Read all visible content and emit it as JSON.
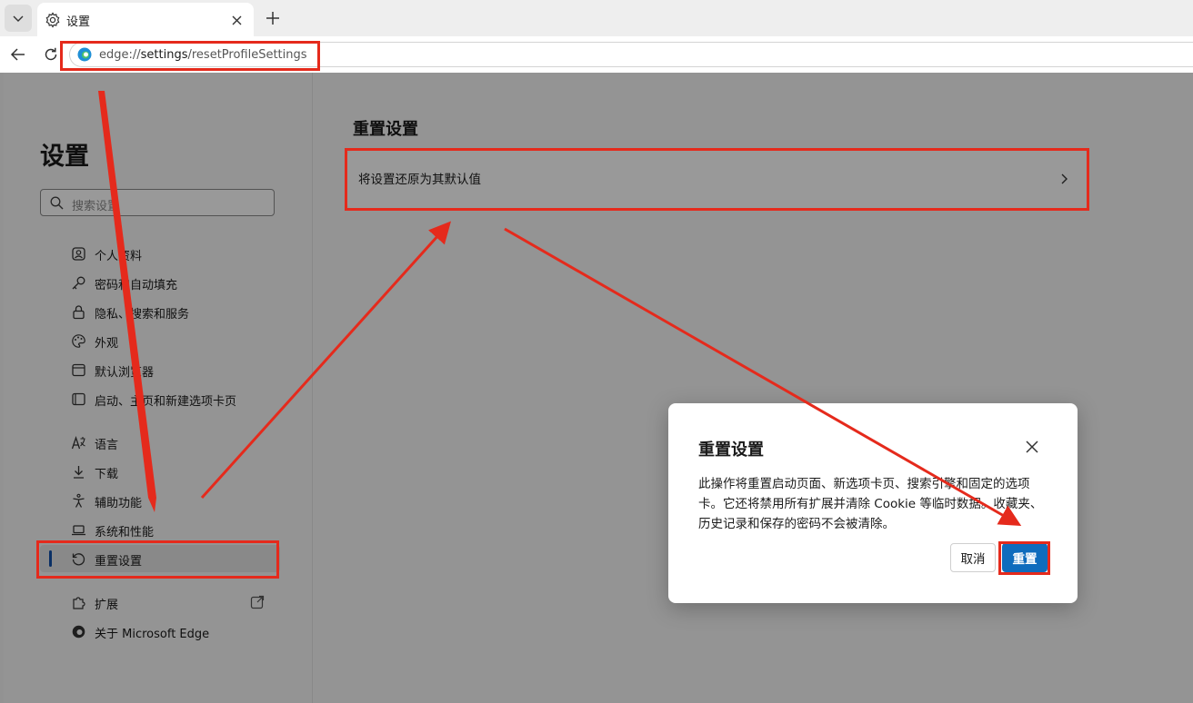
{
  "browser": {
    "tab": {
      "title": "设置",
      "icon": "gear-icon"
    },
    "address": {
      "scheme": "edge://",
      "host": "settings",
      "path": "/resetProfileSettings"
    }
  },
  "sidebar": {
    "title": "设置",
    "search_placeholder": "搜索设置",
    "items": [
      {
        "label": "个人资料",
        "icon": "profile-icon"
      },
      {
        "label": "密码和自动填充",
        "icon": "key-icon"
      },
      {
        "label": "隐私、搜索和服务",
        "icon": "lock-icon"
      },
      {
        "label": "外观",
        "icon": "palette-icon"
      },
      {
        "label": "默认浏览器",
        "icon": "browser-icon"
      },
      {
        "label": "启动、主页和新建选项卡页",
        "icon": "start-page-icon"
      },
      {
        "label": "语言",
        "icon": "language-icon"
      },
      {
        "label": "下载",
        "icon": "download-icon"
      },
      {
        "label": "辅助功能",
        "icon": "accessibility-icon"
      },
      {
        "label": "系统和性能",
        "icon": "laptop-icon"
      },
      {
        "label": "重置设置",
        "icon": "reset-icon",
        "active": true
      },
      {
        "label": "扩展",
        "icon": "puzzle-icon"
      },
      {
        "label": "关于 Microsoft Edge",
        "icon": "edge-icon"
      }
    ]
  },
  "main": {
    "title": "重置设置",
    "card_label": "将设置还原为其默认值"
  },
  "dialog": {
    "title": "重置设置",
    "body": "此操作将重置启动页面、新选项卡页、搜索引擎和固定的选项卡。它还将禁用所有扩展并清除 Cookie 等临时数据。收藏夹、历史记录和保存的密码不会被清除。",
    "cancel_label": "取消",
    "reset_label": "重置"
  },
  "colors": {
    "accent": "#0f6cbd",
    "annotation": "#e52a1c"
  }
}
